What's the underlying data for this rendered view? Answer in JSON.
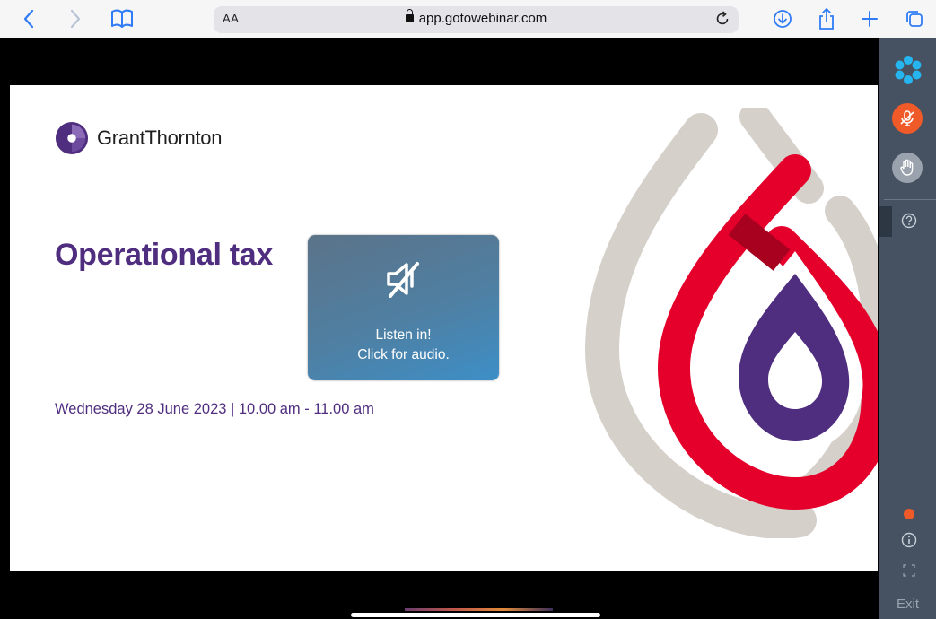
{
  "browser": {
    "text_size_label": "AA",
    "url": "app.gotowebinar.com",
    "icons": [
      "back-icon",
      "forward-icon",
      "bookmarks-icon",
      "lock-icon",
      "reload-icon",
      "downloads-icon",
      "share-icon",
      "new-tab-icon",
      "tabs-icon"
    ]
  },
  "slide": {
    "brand": "GrantThornton",
    "title": "Operational tax",
    "date_line": "Wednesday 28 June 2023  |  10.00 am - 11.00 am",
    "colors": {
      "title": "#4f2d7f",
      "red": "#e4002b",
      "purple": "#4f2d7f",
      "grey": "#d5d0ca"
    }
  },
  "audio_prompt": {
    "line1": "Listen in!",
    "line2": "Click for audio.",
    "icon": "speaker-muted-icon"
  },
  "sidebar": {
    "icons": [
      "gotowebinar-logo-icon",
      "microphone-muted-icon",
      "raise-hand-icon",
      "question-icon",
      "status-dot-icon",
      "info-icon",
      "fullscreen-icon"
    ],
    "exit_label": "Exit",
    "colors": {
      "background": "#465262",
      "mic": "#f05a28",
      "status": "#f05a28"
    }
  }
}
